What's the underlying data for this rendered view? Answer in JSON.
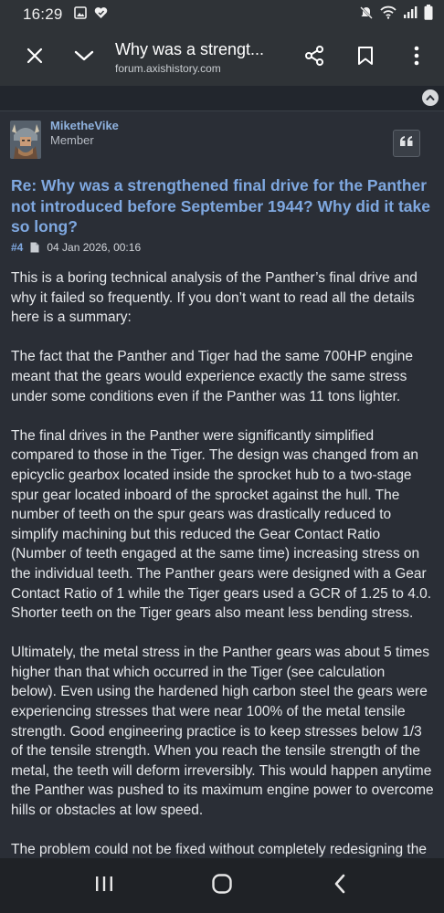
{
  "status_bar": {
    "time": "16:29",
    "left_icons": [
      "image-icon",
      "heart-icon"
    ],
    "right_icons": [
      "mute-icon",
      "wifi-icon",
      "signal-icon",
      "battery-icon"
    ]
  },
  "app_bar": {
    "title": "Why was a strengt...",
    "url": "forum.axishistory.com",
    "icons": [
      "close-icon",
      "chevron-down-icon",
      "share-icon",
      "bookmark-icon",
      "more-vert-icon"
    ]
  },
  "post": {
    "author": "MiketheVike",
    "rank": "Member",
    "title": "Re: Why was a strengthened final drive for the Panther not introduced before September 1944? Why did it take so long?",
    "number": "#4",
    "date": "04 Jan 2026, 00:16",
    "paragraphs": [
      "This is a boring technical analysis of the Panther’s final drive and why it failed so frequently. If you don’t want to read all the details here is a summary:",
      "The fact that the Panther and Tiger had the same 700HP engine meant that the gears would experience exactly the same stress under some conditions even if the Panther was 11 tons lighter.",
      "The final drives in the Panther were significantly simplified compared to those in the Tiger. The design was changed from an epicyclic gearbox located inside the sprocket hub to a two-stage spur gear located inboard of the sprocket against the hull. The number of teeth on the spur gears was drastically reduced to simplify machining but this reduced the Gear Contact Ratio (Number of teeth engaged at the same time) increasing stress on the individual teeth. The Panther gears were designed with a Gear Contact Ratio of 1 while the Tiger gears used a GCR of 1.25 to 4.0. Shorter teeth on the Tiger gears also meant less bending stress.",
      "Ultimately, the metal stress in the Panther gears was about 5 times higher than that which occurred in the Tiger (see calculation below). Even using the hardened high carbon steel the gears were experiencing stresses that were near 100% of the metal tensile strength. Good engineering practice is to keep stresses below 1/3 of the tensile strength. When you reach the tensile strength of the metal, the teeth will deform irreversibly. This would happen anytime the Panther was pushed to its maximum engine power to overcome hills or obstacles at low speed.",
      "The problem could not be fixed without completely redesigning the"
    ]
  },
  "nav_bar": {
    "icons": [
      "recent-apps-icon",
      "home-icon",
      "back-icon"
    ]
  },
  "colors": {
    "background": "#2a2e36",
    "app_bar": "#2f3337",
    "link": "#7fa8e0",
    "text": "#e6e8eb"
  }
}
